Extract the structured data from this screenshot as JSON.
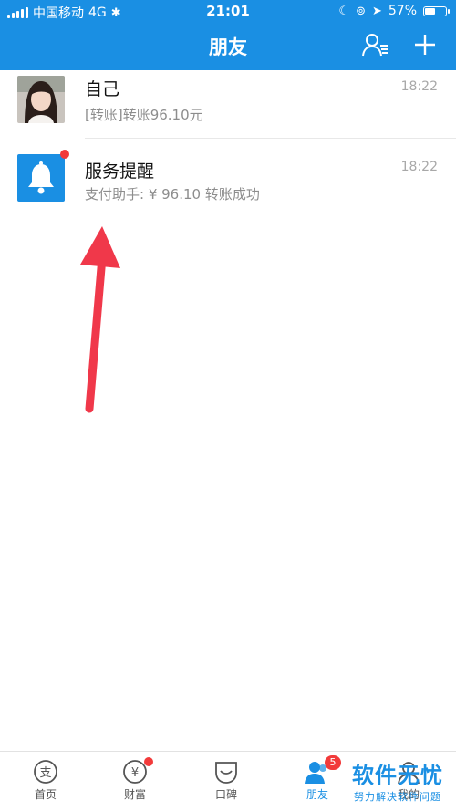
{
  "status_bar": {
    "carrier": "中国移动",
    "network": "4G",
    "time": "21:01",
    "battery": "57%",
    "battery_level": 0.57
  },
  "nav": {
    "title": "朋友",
    "icons": [
      "contacts-icon",
      "add-icon"
    ]
  },
  "conversations": [
    {
      "name": "自己",
      "preview": "[转账]转账96.10元",
      "time": "18:22",
      "avatar": "user-photo"
    },
    {
      "name": "服务提醒",
      "preview": "支付助手: ¥ 96.10 转账成功",
      "time": "18:22",
      "avatar": "bell-icon",
      "unread_dot": true
    }
  ],
  "tabbar": {
    "tabs": [
      {
        "label": "首页",
        "icon": "alipay-home-icon"
      },
      {
        "label": "财富",
        "icon": "wealth-icon",
        "badge_dot": true
      },
      {
        "label": "口碑",
        "icon": "koubei-icon"
      },
      {
        "label": "朋友",
        "icon": "friends-icon",
        "badge": "5",
        "active": true
      },
      {
        "label": "我的",
        "icon": "profile-icon"
      }
    ]
  },
  "watermark": {
    "main": "软件无忧",
    "sub": "努力解决软件问题"
  },
  "colors": {
    "brand": "#1a8fe3",
    "badge": "#f23a3a",
    "annotation_arrow": "#f0384a"
  }
}
